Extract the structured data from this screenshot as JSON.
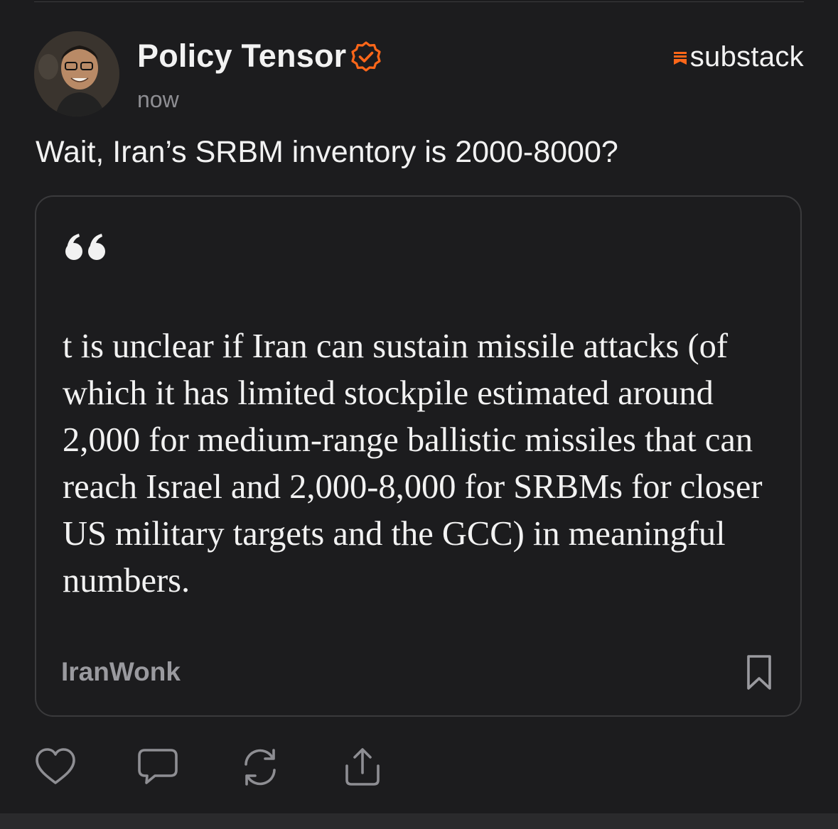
{
  "post": {
    "author": "Policy Tensor",
    "timestamp": "now",
    "brand": "substack",
    "text": "Wait, Iran’s SRBM inventory is 2000-8000?"
  },
  "quote": {
    "text": "t is unclear if Iran can sustain missile attacks (of which it has limited stockpile estimated around 2,000 for medium-range ballistic missiles that can reach Israel and 2,000-8,000 for SRBMs for closer US military targets and the GCC) in meaningful numbers.",
    "source": "IranWonk"
  },
  "icons": {
    "verified": "verified-badge-icon",
    "brand_mark": "substack-logo-icon",
    "quote": "quote-mark-icon",
    "bookmark": "bookmark-icon",
    "like": "heart-icon",
    "comment": "comment-icon",
    "restack": "restack-icon",
    "share": "share-icon"
  },
  "colors": {
    "background": "#1c1c1e",
    "accent": "#ff6719",
    "text": "#f2f2f2",
    "muted": "#8e8e93",
    "border": "#3a3a3c"
  }
}
